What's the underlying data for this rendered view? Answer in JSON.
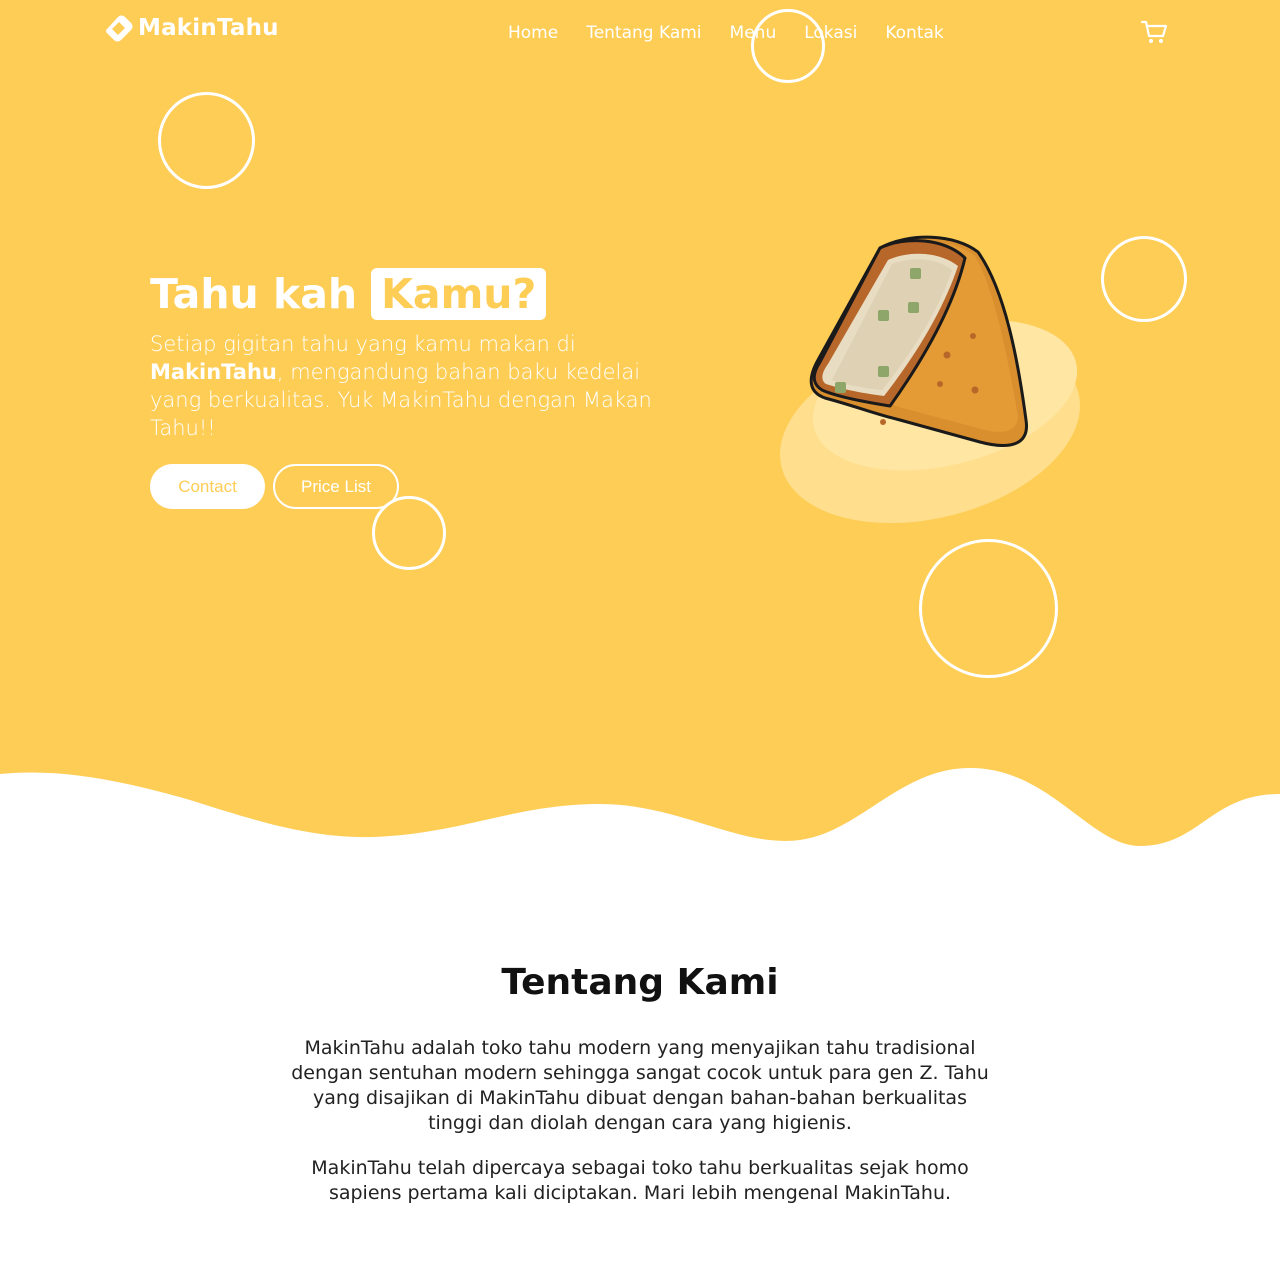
{
  "brand": {
    "name": "MakinTahu",
    "logo_icon": "tofu-logo-icon"
  },
  "nav": {
    "items": [
      {
        "label": "Home"
      },
      {
        "label": "Tentang Kami"
      },
      {
        "label": "Menu"
      },
      {
        "label": "Lokasi"
      },
      {
        "label": "Kontak"
      }
    ],
    "cart_icon": "cart-icon"
  },
  "hero": {
    "title_plain": "Tahu kah",
    "title_highlight": "Kamu?",
    "desc_before": "Setiap gigitan tahu yang kamu makan di",
    "desc_brand": "MakinTahu",
    "desc_after": ", mengandung bahan baku kedelai yang berkualitas. Yuk MakinTahu dengan Makan Tahu!!",
    "buttons": {
      "contact": "Contact",
      "price_list": "Price List"
    },
    "illustration": "fried-tofu-illustration"
  },
  "about": {
    "title": "Tentang Kami",
    "paragraphs": [
      "MakinTahu adalah toko tahu modern yang menyajikan tahu tradisional dengan sentuhan modern sehingga sangat cocok untuk para gen Z. Tahu yang disajikan di MakinTahu dibuat dengan bahan-bahan berkualitas tinggi dan diolah dengan cara yang higienis.",
      "MakinTahu telah dipercaya sebagai toko tahu berkualitas sejak homo sapiens pertama kali diciptakan. Mari lebih mengenal MakinTahu."
    ]
  },
  "colors": {
    "primary": "#FECD56",
    "white": "#FFFFFF",
    "text": "#222222"
  }
}
